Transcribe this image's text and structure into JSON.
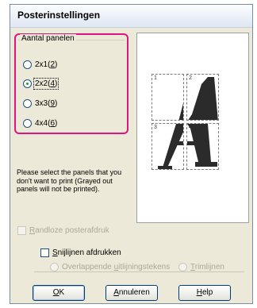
{
  "window": {
    "title": "Posterinstellingen"
  },
  "panels_group": {
    "legend": "Aantal panelen",
    "options": [
      {
        "text": "2x1(",
        "key": "2",
        "close": ")",
        "checked": false
      },
      {
        "text": "2x2(",
        "key": "4",
        "close": ")",
        "checked": true
      },
      {
        "text": "3x3(",
        "key": "9",
        "close": ")",
        "checked": false
      },
      {
        "text": "4x4(",
        "key": "6",
        "close": ")",
        "checked": false
      }
    ]
  },
  "info_text": "Please select the panels that you don't want to print (Grayed out panels will not be printed).",
  "preview": {
    "panel_numbers": [
      "1",
      "2",
      "3",
      "4"
    ]
  },
  "borderless": {
    "key": "R",
    "rest": "andloze posterafdruk",
    "checked": false,
    "enabled": false
  },
  "cut_lines": {
    "key": "S",
    "rest": "nijlijnen afdrukken",
    "checked": false,
    "overlap": {
      "pre": "Overlappende ",
      "key": "u",
      "post": "itlijningstekens"
    },
    "trim": {
      "key": "T",
      "rest": "rimlijnen"
    }
  },
  "buttons": {
    "ok": {
      "key": "O",
      "rest": "K"
    },
    "cancel": {
      "key": "A",
      "rest": "nnuleren"
    },
    "help": {
      "key": "H",
      "rest": "elp"
    }
  }
}
